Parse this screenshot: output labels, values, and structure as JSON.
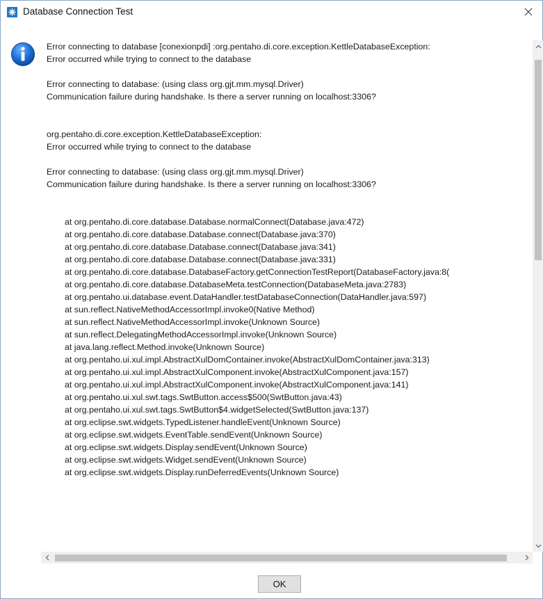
{
  "window": {
    "title": "Database Connection Test",
    "icon": "app-icon",
    "close_glyph": "✕",
    "accent_color": "#1f76c9"
  },
  "message": {
    "icon": "info-icon",
    "lines": [
      {
        "text": "Error connecting to database [conexionpdi] :org.pentaho.di.core.exception.KettleDatabaseException:",
        "indent": false
      },
      {
        "text": "Error occurred while trying to connect to the database",
        "indent": false
      },
      {
        "text": "",
        "indent": false
      },
      {
        "text": "Error connecting to database: (using class org.gjt.mm.mysql.Driver)",
        "indent": false
      },
      {
        "text": "Communication failure during handshake. Is there a server running on localhost:3306?",
        "indent": false
      },
      {
        "text": "",
        "indent": false
      },
      {
        "text": "",
        "indent": false
      },
      {
        "text": "org.pentaho.di.core.exception.KettleDatabaseException:",
        "indent": false
      },
      {
        "text": "Error occurred while trying to connect to the database",
        "indent": false
      },
      {
        "text": "",
        "indent": false
      },
      {
        "text": "Error connecting to database: (using class org.gjt.mm.mysql.Driver)",
        "indent": false
      },
      {
        "text": "Communication failure during handshake. Is there a server running on localhost:3306?",
        "indent": false
      },
      {
        "text": "",
        "indent": false
      },
      {
        "text": "",
        "indent": false
      },
      {
        "text": "at org.pentaho.di.core.database.Database.normalConnect(Database.java:472)",
        "indent": true
      },
      {
        "text": "at org.pentaho.di.core.database.Database.connect(Database.java:370)",
        "indent": true
      },
      {
        "text": "at org.pentaho.di.core.database.Database.connect(Database.java:341)",
        "indent": true
      },
      {
        "text": "at org.pentaho.di.core.database.Database.connect(Database.java:331)",
        "indent": true
      },
      {
        "text": "at org.pentaho.di.core.database.DatabaseFactory.getConnectionTestReport(DatabaseFactory.java:8(",
        "indent": true
      },
      {
        "text": "at org.pentaho.di.core.database.DatabaseMeta.testConnection(DatabaseMeta.java:2783)",
        "indent": true
      },
      {
        "text": "at org.pentaho.ui.database.event.DataHandler.testDatabaseConnection(DataHandler.java:597)",
        "indent": true
      },
      {
        "text": "at sun.reflect.NativeMethodAccessorImpl.invoke0(Native Method)",
        "indent": true
      },
      {
        "text": "at sun.reflect.NativeMethodAccessorImpl.invoke(Unknown Source)",
        "indent": true
      },
      {
        "text": "at sun.reflect.DelegatingMethodAccessorImpl.invoke(Unknown Source)",
        "indent": true
      },
      {
        "text": "at java.lang.reflect.Method.invoke(Unknown Source)",
        "indent": true
      },
      {
        "text": "at org.pentaho.ui.xul.impl.AbstractXulDomContainer.invoke(AbstractXulDomContainer.java:313)",
        "indent": true
      },
      {
        "text": "at org.pentaho.ui.xul.impl.AbstractXulComponent.invoke(AbstractXulComponent.java:157)",
        "indent": true
      },
      {
        "text": "at org.pentaho.ui.xul.impl.AbstractXulComponent.invoke(AbstractXulComponent.java:141)",
        "indent": true
      },
      {
        "text": "at org.pentaho.ui.xul.swt.tags.SwtButton.access$500(SwtButton.java:43)",
        "indent": true
      },
      {
        "text": "at org.pentaho.ui.xul.swt.tags.SwtButton$4.widgetSelected(SwtButton.java:137)",
        "indent": true
      },
      {
        "text": "at org.eclipse.swt.widgets.TypedListener.handleEvent(Unknown Source)",
        "indent": true
      },
      {
        "text": "at org.eclipse.swt.widgets.EventTable.sendEvent(Unknown Source)",
        "indent": true
      },
      {
        "text": "at org.eclipse.swt.widgets.Display.sendEvent(Unknown Source)",
        "indent": true
      },
      {
        "text": "at org.eclipse.swt.widgets.Widget.sendEvent(Unknown Source)",
        "indent": true
      },
      {
        "text": "at org.eclipse.swt.widgets.Display.runDeferredEvents(Unknown Source)",
        "indent": true
      }
    ]
  },
  "scrollbars": {
    "up_glyph": "^",
    "down_glyph": "⌄",
    "left_glyph": "<",
    "right_glyph": ">"
  },
  "buttons": {
    "ok_label": "OK"
  }
}
